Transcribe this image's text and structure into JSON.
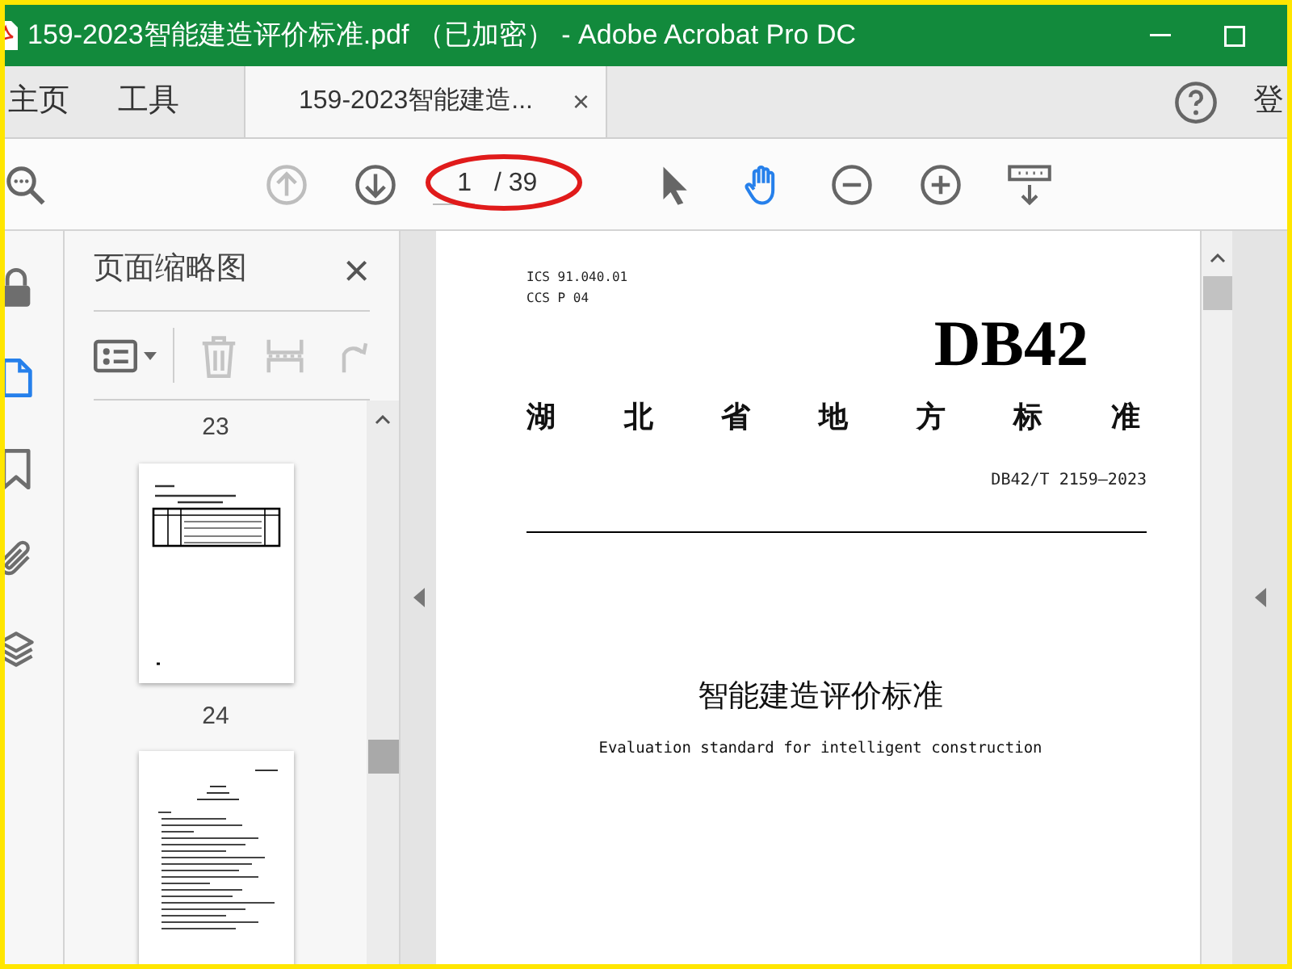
{
  "window": {
    "title": "159-2023智能建造评价标准.pdf （已加密） - Adobe Acrobat Pro DC"
  },
  "tabs": [
    {
      "label": "主页",
      "selected": false
    },
    {
      "label": "工具",
      "selected": false
    },
    {
      "label": "159-2023智能建造...",
      "selected": true,
      "close": "×"
    }
  ],
  "account": {
    "label": "登"
  },
  "toolbar": {
    "nav": [
      {
        "kind": "up",
        "disabled": true
      },
      {
        "kind": "down",
        "disabled": false
      }
    ],
    "page": {
      "value": "1",
      "total": "/ 39",
      "highlighted": true
    },
    "tools": [
      {
        "kind": "select",
        "selected": false
      },
      {
        "kind": "hand",
        "selected": true
      },
      {
        "kind": "zoom_out",
        "selected": false
      },
      {
        "kind": "zoom_in",
        "selected": false
      },
      {
        "kind": "read_mode",
        "selected": false
      }
    ]
  },
  "rail": [
    {
      "kind": "lock",
      "selected": false
    },
    {
      "kind": "pages",
      "selected": true
    },
    {
      "kind": "bookmark",
      "selected": false
    },
    {
      "kind": "attachment",
      "selected": false
    },
    {
      "kind": "layers",
      "selected": false
    }
  ],
  "panel": {
    "title": "页面缩略图",
    "close": "×",
    "tools": [
      {
        "kind": "options",
        "disabled": false
      },
      {
        "kind": "delete",
        "disabled": true
      },
      {
        "kind": "extract",
        "disabled": true
      },
      {
        "kind": "rotate",
        "disabled": true
      }
    ],
    "items": [
      {
        "kind": "label",
        "text": "23"
      },
      {
        "kind": "table_page"
      },
      {
        "kind": "label",
        "text": "24"
      },
      {
        "kind": "text_page"
      }
    ]
  },
  "document": {
    "lines": [
      {
        "kind": "meta",
        "text": "ICS 91.040.01"
      },
      {
        "kind": "meta",
        "text": "CCS P 04"
      },
      {
        "kind": "code",
        "text": "DB42"
      },
      {
        "kind": "org",
        "text": "湖北省地方标准"
      },
      {
        "kind": "number",
        "text": "DB42/T 2159—2023"
      },
      {
        "kind": "rule"
      },
      {
        "kind": "title",
        "text": "智能建造评价标准"
      },
      {
        "kind": "subtitle",
        "text": "Evaluation standard for intelligent construction"
      }
    ]
  }
}
